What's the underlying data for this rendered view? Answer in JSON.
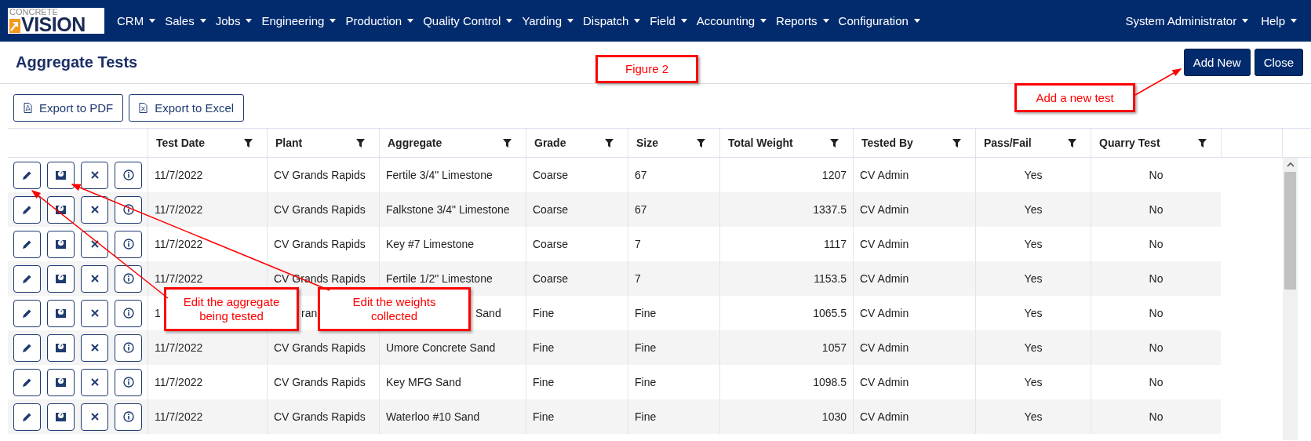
{
  "nav": {
    "logo": {
      "top": "CONCRETE",
      "bottom": "VISION"
    },
    "menus": [
      "CRM",
      "Sales",
      "Jobs",
      "Engineering",
      "Production",
      "Quality Control",
      "Yarding",
      "Dispatch",
      "Field",
      "Accounting",
      "Reports",
      "Configuration"
    ],
    "right_menus": [
      "System Administrator",
      "Help"
    ]
  },
  "page": {
    "title": "Aggregate Tests",
    "buttons": [
      "Add New",
      "Close"
    ]
  },
  "toolbar": {
    "buttons": [
      {
        "label": "Export to PDF",
        "kind": "pdf"
      },
      {
        "label": "Export to Excel",
        "kind": "excel"
      }
    ]
  },
  "table": {
    "columns": [
      "Test Date",
      "Plant",
      "Aggregate",
      "Grade",
      "Size",
      "Total Weight",
      "Tested By",
      "Pass/Fail",
      "Quarry Test"
    ],
    "rows": [
      {
        "covered": false,
        "cells": [
          "11/7/2022",
          "CV Grands Rapids",
          "Fertile 3/4\" Limestone",
          "Coarse",
          "67",
          "1207",
          "CV Admin",
          "Yes",
          "No"
        ]
      },
      {
        "covered": false,
        "cells": [
          "11/7/2022",
          "CV Grands Rapids",
          "Falkstone 3/4\" Limestone",
          "Coarse",
          "67",
          "1337.5",
          "CV Admin",
          "Yes",
          "No"
        ]
      },
      {
        "covered": false,
        "cells": [
          "11/7/2022",
          "CV Grands Rapids",
          "Key #7 Limestone",
          "Coarse",
          "7",
          "1117",
          "CV Admin",
          "Yes",
          "No"
        ]
      },
      {
        "covered": false,
        "cells": [
          "11/7/2022",
          "CV Grands Rapids",
          "Fertile 1/2\" Limestone",
          "Coarse",
          "7",
          "1153.5",
          "CV Admin",
          "Yes",
          "No"
        ]
      },
      {
        "covered": true,
        "cells": [
          "1",
          "ran",
          "Sand",
          "Fine",
          "Fine",
          "1065.5",
          "CV Admin",
          "Yes",
          "No"
        ]
      },
      {
        "covered": false,
        "cells": [
          "11/7/2022",
          "CV Grands Rapids",
          "Umore Concrete Sand",
          "Fine",
          "Fine",
          "1057",
          "CV Admin",
          "Yes",
          "No"
        ]
      },
      {
        "covered": false,
        "cells": [
          "11/7/2022",
          "CV Grands Rapids",
          "Key MFG Sand",
          "Fine",
          "Fine",
          "1098.5",
          "CV Admin",
          "Yes",
          "No"
        ]
      },
      {
        "covered": false,
        "cells": [
          "11/7/2022",
          "CV Grands Rapids",
          "Waterloo #10 Sand",
          "Fine",
          "Fine",
          "1030",
          "CV Admin",
          "Yes",
          "No"
        ]
      }
    ]
  },
  "annotations": [
    {
      "text": "Figure 2",
      "kind": "label"
    },
    {
      "text": "Add a new test",
      "kind": "arrow"
    },
    {
      "text": "Edit the aggregate being tested",
      "kind": "arrow"
    },
    {
      "text": "Edit the weights collected",
      "kind": "arrow"
    }
  ]
}
